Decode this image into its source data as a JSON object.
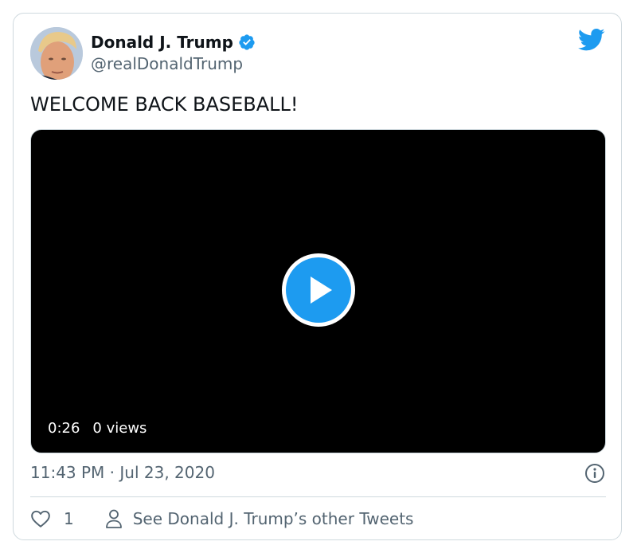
{
  "tweet": {
    "display_name": "Donald J. Trump",
    "handle": "@realDonaldTrump",
    "verified": true,
    "text": "WELCOME BACK BASEBALL!",
    "timestamp": "11:43 PM · Jul 23, 2020"
  },
  "video": {
    "duration": "0:26",
    "views": "0 views"
  },
  "actions": {
    "like_count": "1",
    "profile_link": "See Donald J. Trump’s other Tweets"
  },
  "icons": {
    "brand": "twitter-bird-icon",
    "verified": "verified-badge-icon",
    "play": "play-icon",
    "info": "info-icon",
    "like": "heart-icon",
    "profile": "person-icon"
  },
  "colors": {
    "accent": "#1d9bf0",
    "text_primary": "#0f1419",
    "text_secondary": "#536471",
    "border": "#cfd9de",
    "video_background": "#000000"
  }
}
